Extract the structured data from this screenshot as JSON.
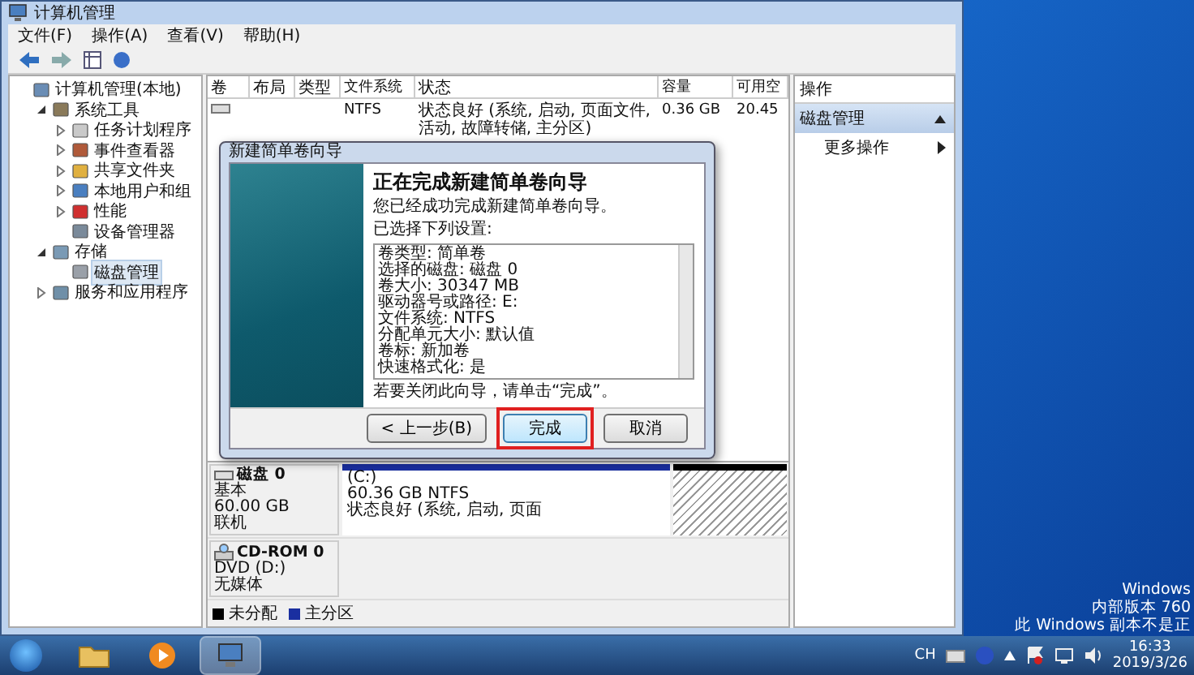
{
  "window": {
    "title": "计算机管理"
  },
  "menu": [
    "文件(F)",
    "操作(A)",
    "查看(V)",
    "帮助(H)"
  ],
  "tree": [
    {
      "label": "计算机管理(本地)",
      "kind": "computer",
      "selected": false,
      "children": [
        {
          "label": "系统工具",
          "kind": "tools",
          "expanded": true,
          "selected": false,
          "children": [
            {
              "label": "任务计划程序",
              "kind": "clock",
              "expanded": false,
              "selected": false
            },
            {
              "label": "事件查看器",
              "kind": "log",
              "expanded": false,
              "selected": false
            },
            {
              "label": "共享文件夹",
              "kind": "folder",
              "expanded": false,
              "selected": false
            },
            {
              "label": "本地用户和组",
              "kind": "users",
              "expanded": false,
              "selected": false
            },
            {
              "label": "性能",
              "kind": "gauge",
              "expanded": false,
              "selected": false
            },
            {
              "label": "设备管理器",
              "kind": "device",
              "selected": false
            }
          ]
        },
        {
          "label": "存储",
          "kind": "storage",
          "expanded": true,
          "selected": false,
          "children": [
            {
              "label": "磁盘管理",
              "kind": "disk",
              "selected": true
            }
          ]
        },
        {
          "label": "服务和应用程序",
          "kind": "services",
          "expanded": false,
          "selected": false
        }
      ]
    }
  ],
  "volume_table": {
    "columns": [
      "卷",
      "布局",
      "类型",
      "文件系统",
      "状态",
      "容量",
      "可用空"
    ],
    "rows": [
      {
        "file_system": "NTFS",
        "status": "状态良好 (系统, 启动, 页面文件, 活动, 故障转储, 主分区)",
        "capacity": "0.36 GB",
        "free": "20.45"
      }
    ]
  },
  "disks": [
    {
      "kind": "disk",
      "name": "磁盘 0",
      "lines": [
        "基本",
        "60.00 GB",
        "联机"
      ],
      "partitions": [
        {
          "kind": "primary",
          "label": "(C:)",
          "size": "60.36 GB NTFS",
          "status": "状态良好 (系统, 启动, 页面"
        },
        {
          "kind": "unallocated"
        }
      ]
    },
    {
      "kind": "cdrom",
      "name": "CD-ROM 0",
      "lines": [
        "DVD (D:)",
        "无媒体"
      ]
    }
  ],
  "legend": [
    {
      "label": "未分配",
      "color": "#000000"
    },
    {
      "label": "主分区",
      "color": "#1a2fa0"
    }
  ],
  "actions": {
    "title": "操作",
    "section": {
      "label": "磁盘管理",
      "expanded": true
    },
    "items": [
      "更多操作"
    ]
  },
  "dialog": {
    "title": "新建简单卷向导",
    "heading": "正在完成新建简单卷向导",
    "message": "您已经成功完成新建简单卷向导。",
    "settings_label": "已选择下列设置:",
    "settings": [
      "卷类型: 简单卷",
      "选择的磁盘: 磁盘 0",
      "卷大小: 30347 MB",
      "驱动器号或路径: E:",
      "文件系统: NTFS",
      "分配单元大小: 默认值",
      "卷标: 新加卷",
      "快速格式化: 是"
    ],
    "close_hint": "若要关闭此向导，请单击“完成”。",
    "buttons": [
      {
        "label": "< 上一步(B)",
        "highlighted": false,
        "default": false
      },
      {
        "label": "完成",
        "highlighted": true,
        "default": true
      },
      {
        "label": "取消",
        "highlighted": false,
        "default": false
      }
    ]
  },
  "activation_notice": [
    "Windows",
    "内部版本 760",
    "此 Windows 副本不是正"
  ],
  "taskbar": {
    "apps": [
      {
        "kind": "folder",
        "active": false
      },
      {
        "kind": "media",
        "active": false
      },
      {
        "kind": "management",
        "active": true
      }
    ],
    "language": "CH",
    "time": "16:33",
    "date": "2019/3/26"
  }
}
